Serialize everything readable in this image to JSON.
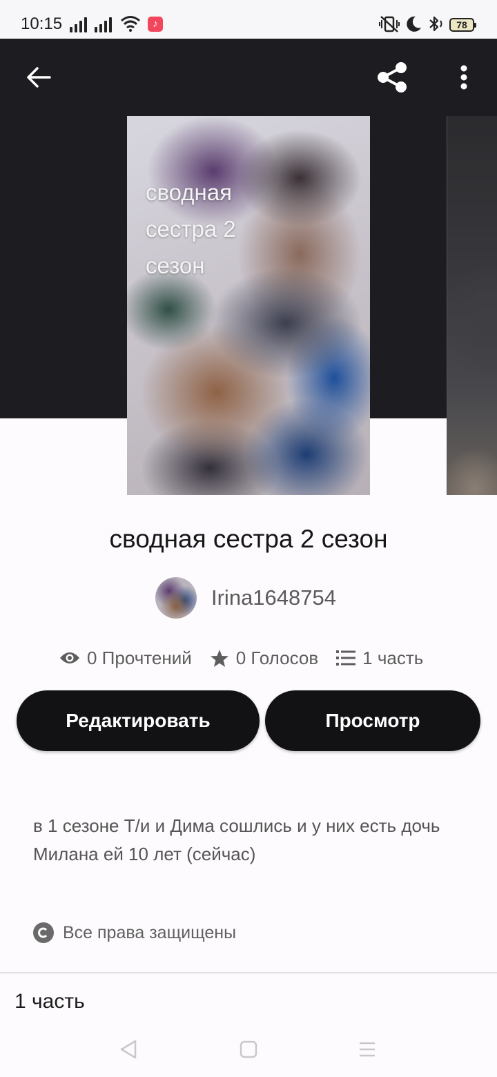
{
  "status_bar": {
    "time": "10:15",
    "battery_level": "78",
    "icons": [
      "signal-icon",
      "signal-icon",
      "wifi-icon",
      "music-app-icon",
      "vibrate-off-icon",
      "do-not-disturb-moon-icon",
      "bluetooth-icon",
      "battery-icon"
    ]
  },
  "header": {
    "back_icon": "arrow-left-icon",
    "share_icon": "share-icon",
    "more_icon": "more-vertical-icon"
  },
  "cover": {
    "title_lines": [
      "сводная",
      "сестра 2",
      "сезон"
    ]
  },
  "story": {
    "title": "сводная сестра 2 сезон",
    "author": "Irina1648754",
    "stats": {
      "reads": "0 Прочтений",
      "votes": "0 Голосов",
      "parts": "1 часть"
    },
    "edit_label": "Редактировать",
    "view_label": "Просмотр",
    "description": "в 1 сезоне Т/и и Дима сошлись и у них есть дочь Милана ей 10 лет (сейчас)",
    "rights": "Все права защищены"
  },
  "parts_section": {
    "label": "1 часть"
  },
  "colors": {
    "header_bg": "#1d1c20",
    "button_bg": "#121113",
    "page_bg": "#fdfbfd"
  }
}
